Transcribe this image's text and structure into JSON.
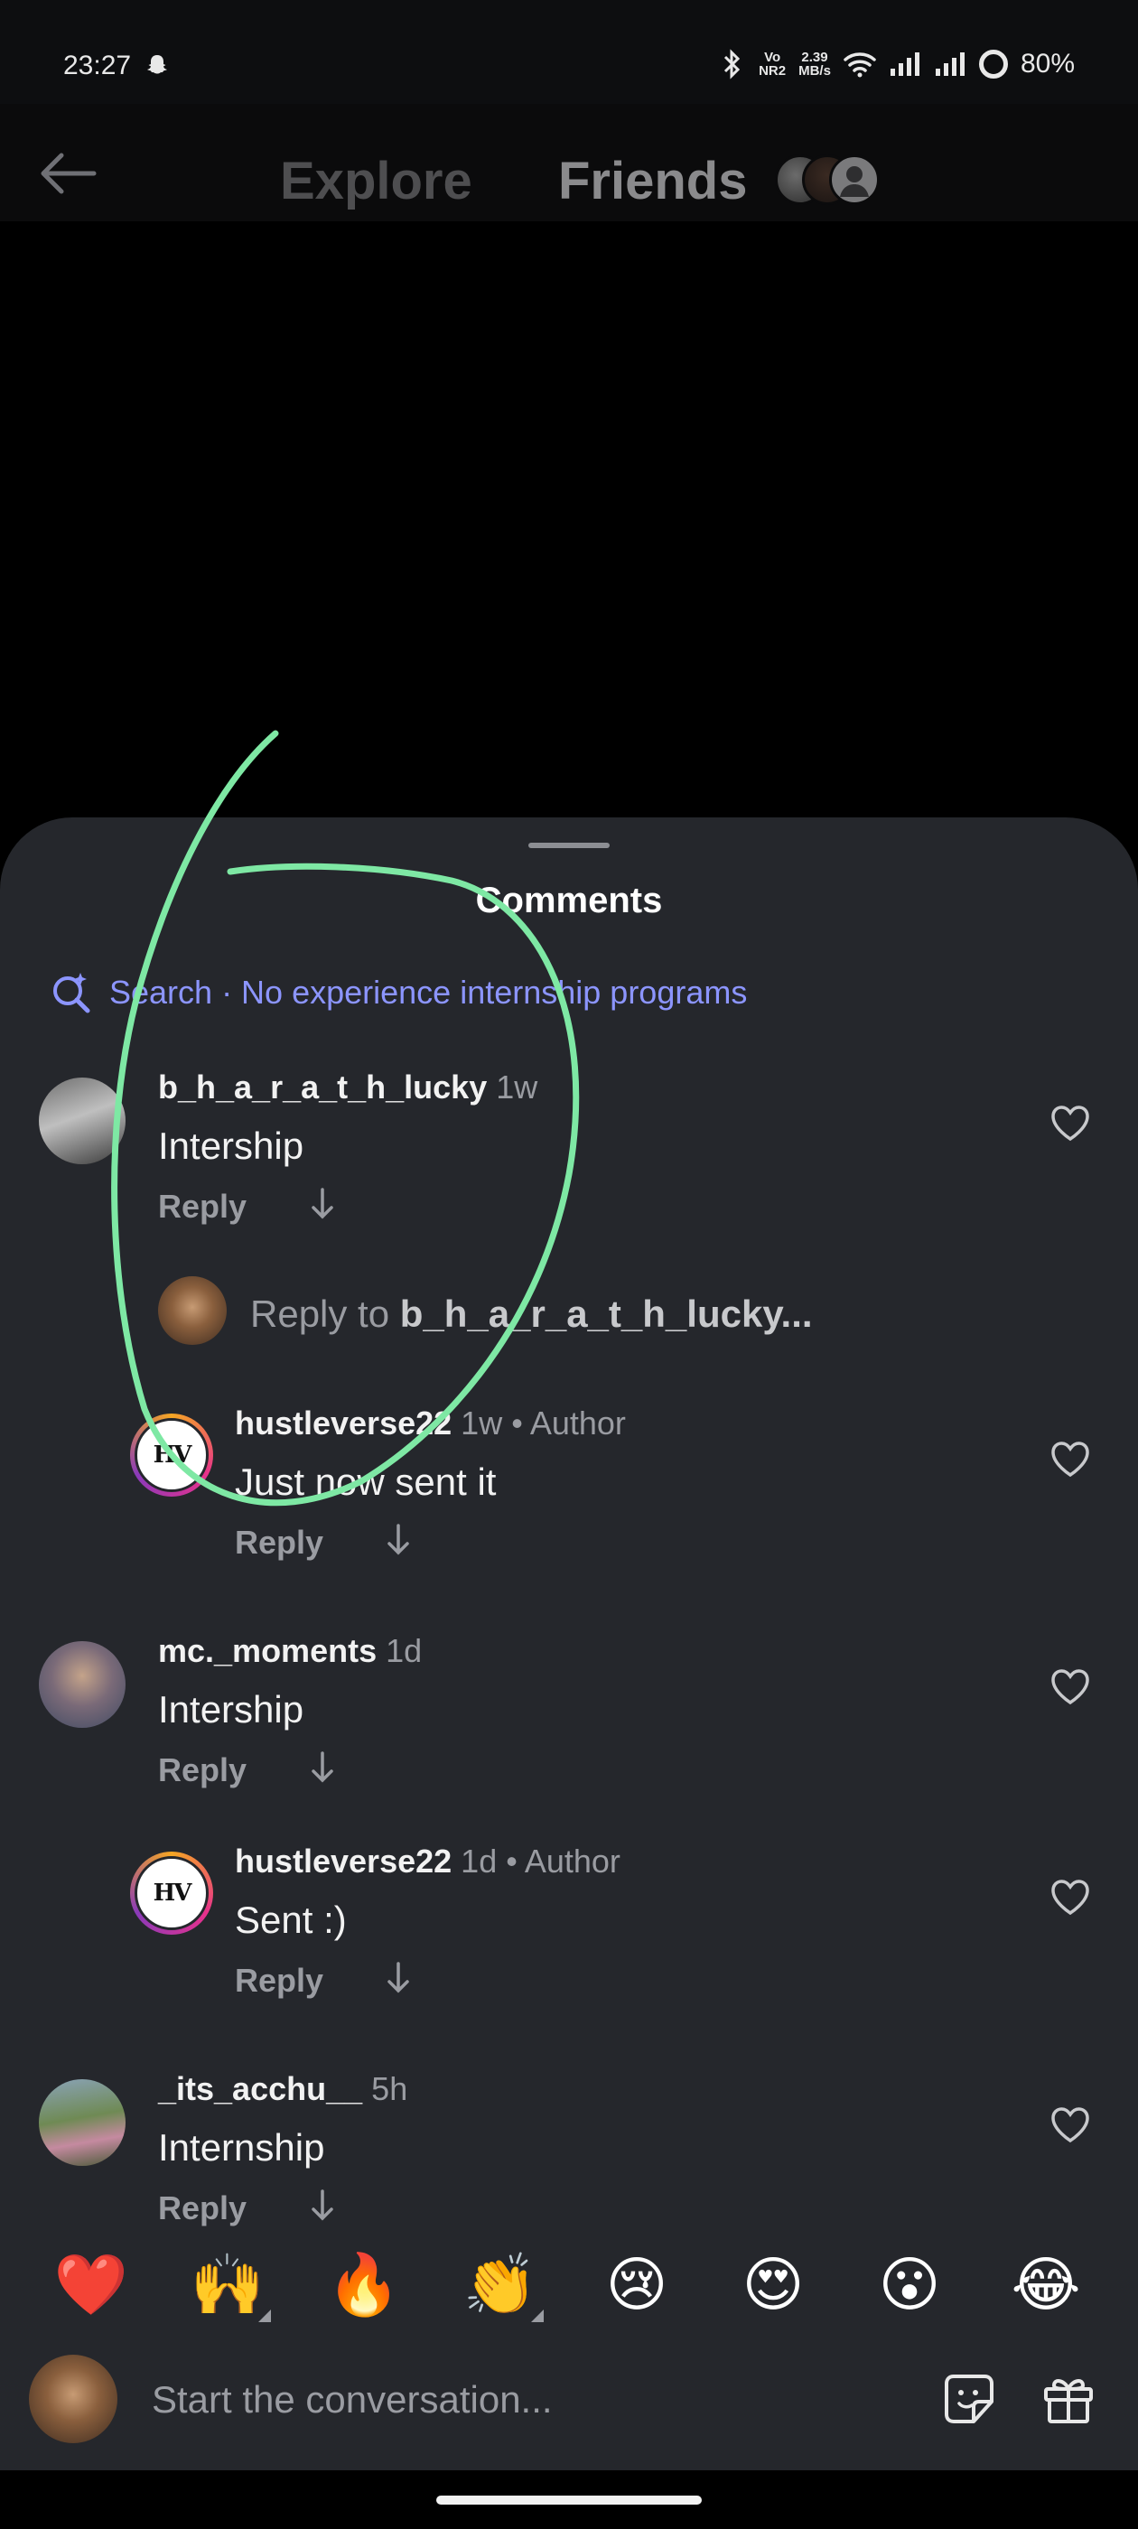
{
  "status_bar": {
    "time": "23:27",
    "net_top": "2.39",
    "net_bottom": "MB/s",
    "volte": "Vo",
    "nr": "NR2",
    "battery": "80%"
  },
  "header": {
    "tab_explore": "Explore",
    "tab_friends": "Friends"
  },
  "sheet": {
    "title": "Comments",
    "search": "Search · No experience internship programs"
  },
  "comments": [
    {
      "user": "b_h_a_r_a_t_h_lucky",
      "time": "1w",
      "text": "Intership",
      "reply": "Reply"
    },
    {
      "user": "hustleverse22",
      "time": "1w",
      "author": " • Author",
      "text": "Just now sent it",
      "reply": "Reply"
    },
    {
      "user": "mc._moments",
      "time": "1d",
      "text": "Intership",
      "reply": "Reply"
    },
    {
      "user": "hustleverse22",
      "time": "1d",
      "author": " • Author",
      "text": "Sent :)",
      "reply": "Reply"
    },
    {
      "user": "_its_acchu__",
      "time": "5h",
      "text": "Internship",
      "reply": "Reply"
    }
  ],
  "reply_to": {
    "prefix": "Reply to ",
    "user": "b_h_a_r_a_t_h_lucky..."
  },
  "hv_logo_text": "HV",
  "emojis": [
    "❤️",
    "🙌",
    "🔥",
    "👏",
    "😢",
    "😍",
    "😮",
    "😂"
  ],
  "composer": {
    "placeholder": "Start the conversation..."
  },
  "colors": {
    "sheet_bg": "#25272c",
    "accent_search": "#8c95ff",
    "annotation_stroke": "#7ee8a4"
  }
}
